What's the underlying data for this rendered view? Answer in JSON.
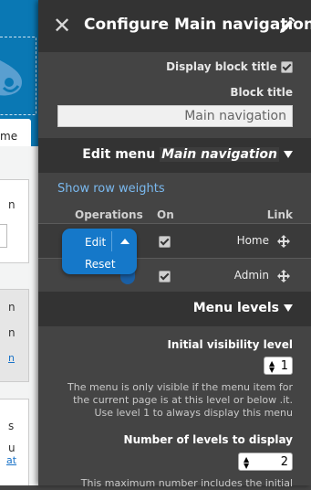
{
  "background_page": {
    "tab_label": "me",
    "fragments": [
      "n",
      "n",
      "n",
      "s",
      "u"
    ],
    "link_fragments": [
      "n",
      "at"
    ]
  },
  "tray": {
    "title": "Configure Main navigation",
    "display_block_title_label": "Display block title",
    "display_block_title_checked": true,
    "block_title_label": "Block title",
    "block_title_value": "Main navigation",
    "edit_menu": {
      "prefix": "Edit menu",
      "menu_name": "Main navigation"
    },
    "show_row_weights": "Show row weights",
    "table_headers": {
      "operations": "Operations",
      "on": "On",
      "link": "Link"
    },
    "rows": [
      {
        "label": "Home",
        "enabled": true
      },
      {
        "label": "Admin",
        "enabled": true
      }
    ],
    "operations_dropdown": {
      "edit": "Edit",
      "reset": "Reset"
    },
    "menu_levels": {
      "title": "Menu levels",
      "initial_visibility_label": "Initial visibility level",
      "initial_visibility_value": "1",
      "initial_visibility_help": "The menu is only visible if the menu item for the current page is at this level or below .it. Use level 1 to always display this menu",
      "levels_to_display_label": "Number of levels to display",
      "levels_to_display_value": "2",
      "levels_to_display_help": "This maximum number includes the initial"
    }
  },
  "colors": {
    "tray_bg": "#444444",
    "tray_bar": "#333333",
    "link_blue": "#7ab9ef",
    "dropbutton_blue": "#1578c9",
    "header_blue": "#0a78b4"
  }
}
